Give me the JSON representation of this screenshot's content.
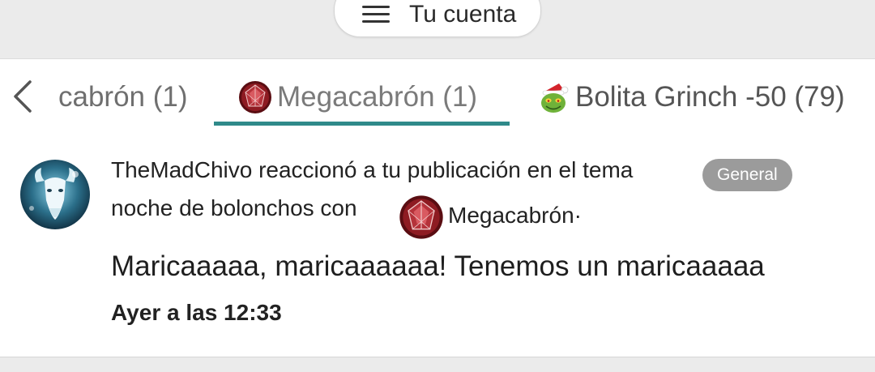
{
  "header": {
    "account_label": "Tu cuenta"
  },
  "tabs": [
    {
      "label": "cabrón (1)",
      "active": false
    },
    {
      "label": "Megacabrón (1)",
      "active": true,
      "icon": "megacabron-gem-icon"
    },
    {
      "label": "Bolita Grinch -50 (79)",
      "active": false,
      "icon": "grinch-santa-icon"
    }
  ],
  "colors": {
    "accent": "#2f8a8a",
    "badge": "#9b9b9b"
  },
  "notification": {
    "text_line1": "TheMadChivo reaccionó a tu publicación en el tema",
    "topic_badge": "General",
    "text_line2": "noche de bolonchos con",
    "reaction_name": "Megacabrón·",
    "quote": "Maricaaaaa, maricaaaaaa! Tenemos un maricaaaaa",
    "time": "Ayer a las 12:33"
  }
}
